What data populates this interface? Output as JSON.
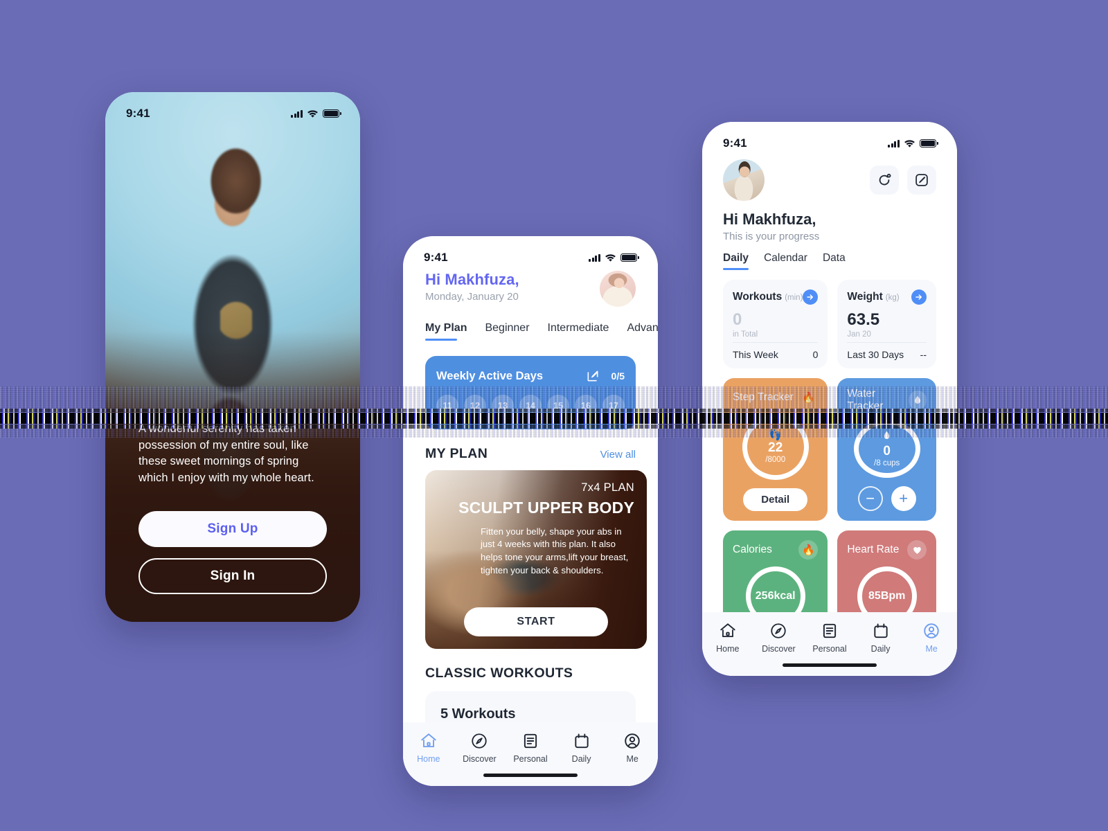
{
  "theme": {
    "background": "#6a6cb6",
    "accent_blue": "#4f8ef7",
    "accent_indigo": "#6366f1"
  },
  "phone_left": {
    "status": {
      "time": "9:41"
    },
    "quote": "A wonderful serenity has taken possession of my entire soul, like these sweet mornings of spring which I enjoy with my whole heart.",
    "sign_up_label": "Sign Up",
    "sign_in_label": "Sign In"
  },
  "phone_mid": {
    "status": {
      "time": "9:41"
    },
    "greeting": "Hi Makhfuza,",
    "date": "Monday, January 20",
    "tabs": [
      {
        "label": "My Plan",
        "active": true
      },
      {
        "label": "Beginner",
        "active": false
      },
      {
        "label": "Intermediate",
        "active": false
      },
      {
        "label": "Advanced",
        "active": false
      }
    ],
    "weekly": {
      "title": "Weekly Active Days",
      "count": "0/5",
      "days": [
        "11",
        "12",
        "13",
        "14",
        "15",
        "16",
        "17"
      ]
    },
    "my_plan": {
      "section_title": "MY PLAN",
      "view_all": "View all",
      "kicker": "7x4 PLAN",
      "title": "SCULPT UPPER BODY",
      "description": "Fitten your belly, shape your abs in just 4 weeks with this plan. It also helps tone your arms,lift your breast, tighten your back & shoulders.",
      "start_label": "START"
    },
    "classic": {
      "section_title": "CLASSIC WORKOUTS",
      "card_title": "5 Workouts"
    },
    "tabbar": [
      {
        "label": "Home",
        "icon": "home-icon",
        "active": true
      },
      {
        "label": "Discover",
        "icon": "compass-icon",
        "active": false
      },
      {
        "label": "Personal",
        "icon": "document-icon",
        "active": false
      },
      {
        "label": "Daily",
        "icon": "calendar-icon",
        "active": false
      },
      {
        "label": "Me",
        "icon": "person-icon",
        "active": false
      }
    ]
  },
  "phone_right": {
    "status": {
      "time": "9:41"
    },
    "actions": [
      {
        "icon": "refresh-icon"
      },
      {
        "icon": "edit-icon"
      }
    ],
    "greeting": "Hi Makhfuza,",
    "subtitle": "This is your  progress",
    "tabs": [
      {
        "label": "Daily",
        "active": true
      },
      {
        "label": "Calendar",
        "active": false
      },
      {
        "label": "Data",
        "active": false
      }
    ],
    "stats": [
      {
        "name": "Workouts",
        "unit": "(min)",
        "value": "0",
        "sub": "in Total",
        "foot_label": "This Week",
        "foot_value": "0",
        "muted": true
      },
      {
        "name": "Weight",
        "unit": "(kg)",
        "value": "63.5",
        "sub": "Jan 20",
        "foot_label": "Last 30 Days",
        "foot_value": "--",
        "muted": false
      }
    ],
    "trackers": [
      {
        "name": "Step Tracker",
        "badge_icon": "flame-icon",
        "glyph": "footprints-icon",
        "value": "22",
        "goal": "/8000",
        "action_label": "Detail",
        "color": "#eaa263"
      },
      {
        "name": "Water Tracker",
        "badge_icon": "water-drop-icon",
        "glyph": "droplet-icon",
        "value": "0",
        "goal": "/8 cups",
        "color": "#5d9ae0"
      },
      {
        "name": "Calories",
        "badge_icon": "flame-icon",
        "glyph": "",
        "value": "256kcal",
        "goal": "",
        "color": "#5cb27e"
      },
      {
        "name": "Heart Rate",
        "badge_icon": "heart-icon",
        "glyph": "",
        "value": "85Bpm",
        "goal": "",
        "color": "#d07a7a"
      }
    ],
    "tabbar": [
      {
        "label": "Home",
        "icon": "home-icon",
        "active": false
      },
      {
        "label": "Discover",
        "icon": "compass-icon",
        "active": false
      },
      {
        "label": "Personal",
        "icon": "document-icon",
        "active": false
      },
      {
        "label": "Daily",
        "icon": "calendar-icon",
        "active": false
      },
      {
        "label": "Me",
        "icon": "person-icon",
        "active": true
      }
    ]
  }
}
